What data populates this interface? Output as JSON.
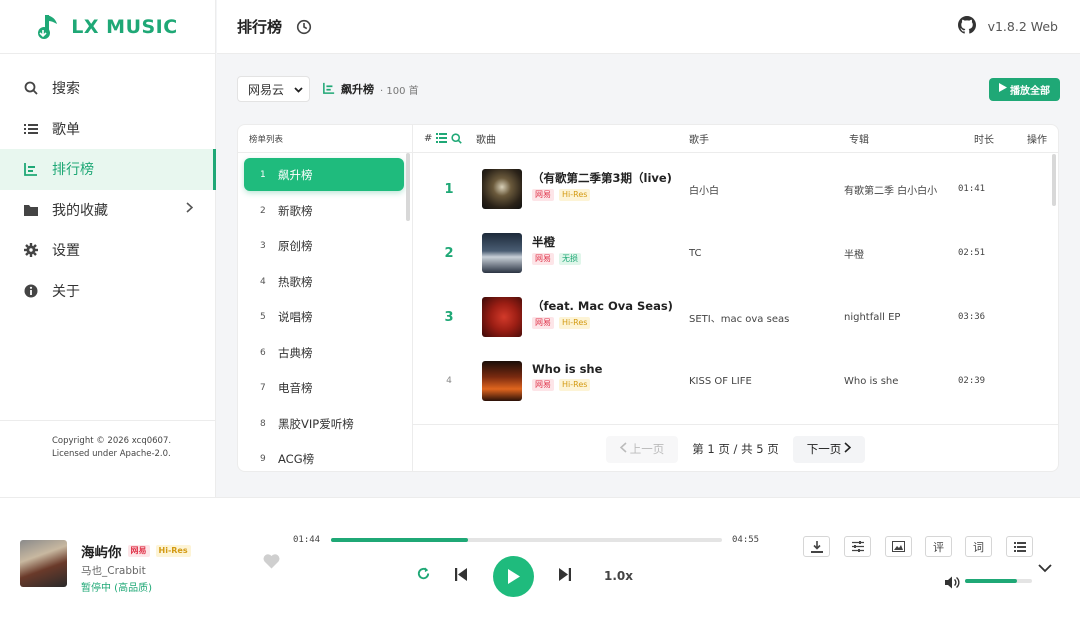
{
  "app": {
    "name": "LX MUSIC",
    "version": "v1.8.2 Web",
    "copyright_line1": "Copyright © 2026 xcq0607.",
    "copyright_line2": "Licensed under Apache-2.0."
  },
  "sidebar": {
    "items": [
      {
        "label": "搜索",
        "icon": "search-icon"
      },
      {
        "label": "歌单",
        "icon": "list-icon"
      },
      {
        "label": "排行榜",
        "icon": "chart-icon",
        "active": true
      },
      {
        "label": "我的收藏",
        "icon": "folder-icon"
      },
      {
        "label": "设置",
        "icon": "gear-icon"
      },
      {
        "label": "关于",
        "icon": "info-icon"
      }
    ]
  },
  "header": {
    "title": "排行榜"
  },
  "filter": {
    "source": "网易云",
    "board_name": "飙升榜",
    "board_count": "· 100 首",
    "play_all": "播放全部"
  },
  "board_list": {
    "header": "榜单列表",
    "items": [
      {
        "num": "1",
        "name": "飙升榜"
      },
      {
        "num": "2",
        "name": "新歌榜"
      },
      {
        "num": "3",
        "name": "原创榜"
      },
      {
        "num": "4",
        "name": "热歌榜"
      },
      {
        "num": "5",
        "name": "说唱榜"
      },
      {
        "num": "6",
        "name": "古典榜"
      },
      {
        "num": "7",
        "name": "电音榜"
      },
      {
        "num": "8",
        "name": "黑胶VIP爱听榜"
      },
      {
        "num": "9",
        "name": "ACG榜"
      }
    ]
  },
  "song_table": {
    "headers": {
      "num": "#",
      "title": "歌曲",
      "singer": "歌手",
      "album": "专辑",
      "duration": "时长",
      "action": "操作"
    },
    "rows": [
      {
        "rank": "1",
        "title": "（有歌第二季第3期（live)",
        "tags": [
          {
            "text": "网易",
            "style": "red"
          },
          {
            "text": "Hi-Res",
            "style": "gold"
          }
        ],
        "singer": "白小白",
        "album": "有歌第二季 白小白小",
        "duration": "01:41"
      },
      {
        "rank": "2",
        "title": "半橙",
        "tags": [
          {
            "text": "网易",
            "style": "red"
          },
          {
            "text": "无损",
            "style": "green"
          }
        ],
        "singer": "TC",
        "album": "半橙",
        "duration": "02:51"
      },
      {
        "rank": "3",
        "title": "（feat. Mac Ova Seas)",
        "tags": [
          {
            "text": "网易",
            "style": "red"
          },
          {
            "text": "Hi-Res",
            "style": "gold"
          }
        ],
        "singer": "SETI、mac ova seas",
        "album": "nightfall EP",
        "duration": "03:36"
      },
      {
        "rank": "4",
        "title": "Who is she",
        "tags": [
          {
            "text": "网易",
            "style": "red"
          },
          {
            "text": "Hi-Res",
            "style": "gold"
          }
        ],
        "singer": "KISS OF LIFE",
        "album": "Who is she",
        "duration": "02:39"
      }
    ]
  },
  "pagination": {
    "prev": "上一页",
    "info": "第 1 页 / 共 5 页",
    "next": "下一页"
  },
  "player": {
    "title": "海屿你",
    "tag_source": "网易",
    "tag_quality": "Hi-Res",
    "artist": "马也_Crabbit",
    "status": "暂停中 (高品质)",
    "current_time": "01:44",
    "total_time": "04:55",
    "progress": 0.35,
    "rate": "1.0x",
    "volume": 0.78,
    "tools": [
      {
        "icon": "download-icon",
        "label": ""
      },
      {
        "icon": "equalizer-icon",
        "label": ""
      },
      {
        "icon": "image-icon",
        "label": ""
      },
      {
        "icon": "comment-icon",
        "label": "评"
      },
      {
        "icon": "lyric-icon",
        "label": "词"
      },
      {
        "icon": "playlist-icon",
        "label": ""
      }
    ]
  },
  "colors": {
    "accent": "#1fa876",
    "accent_bright": "#1fbb7d",
    "tag_red": "#e0354b",
    "tag_gold": "#d39a12"
  }
}
